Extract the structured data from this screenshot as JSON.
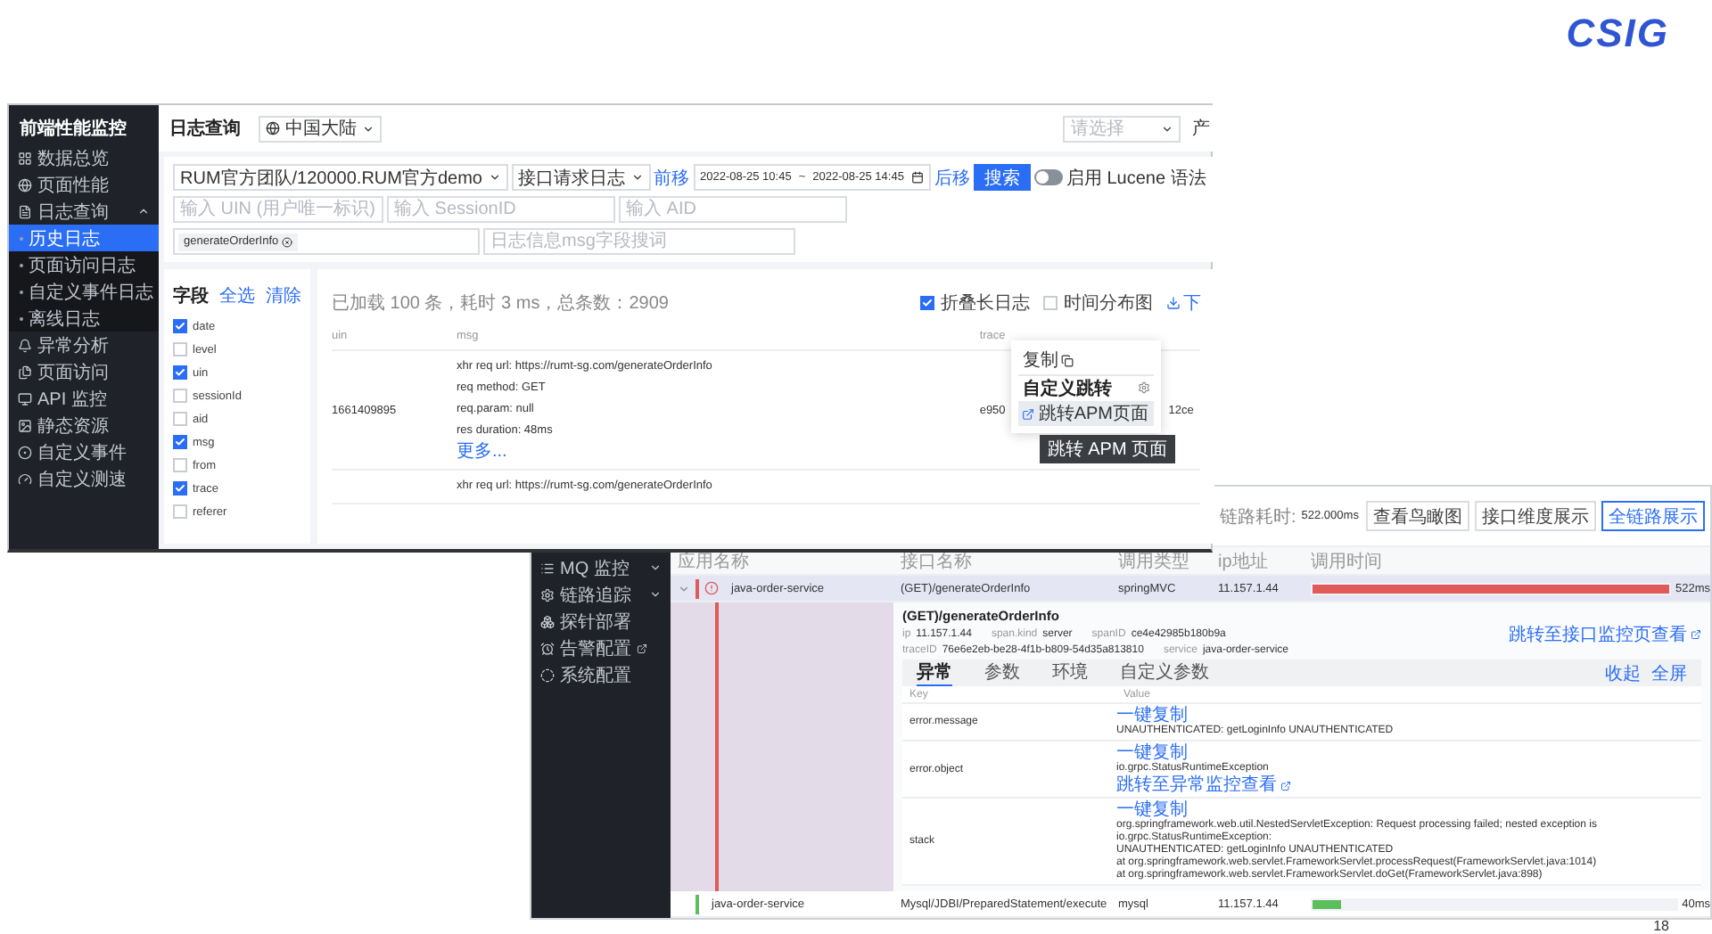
{
  "logo": {
    "text": "CSIG"
  },
  "page_number": "18",
  "log_query_window": {
    "sidebar": {
      "title": "前端性能监控",
      "items": [
        {
          "label": "数据总览",
          "selected": false
        },
        {
          "label": "页面性能",
          "selected": false
        },
        {
          "label": "日志查询",
          "selected": false,
          "expanded": true,
          "children": [
            {
              "label": "历史日志",
              "selected": true
            },
            {
              "label": "页面访问日志",
              "selected": false
            },
            {
              "label": "自定义事件日志",
              "selected": false
            },
            {
              "label": "离线日志",
              "selected": false
            }
          ]
        },
        {
          "label": "异常分析",
          "selected": false
        },
        {
          "label": "页面访问",
          "selected": false
        },
        {
          "label": "API 监控",
          "selected": false
        },
        {
          "label": "静态资源",
          "selected": false
        },
        {
          "label": "自定义事件",
          "selected": false
        },
        {
          "label": "自定义测速",
          "selected": false
        }
      ]
    },
    "header": {
      "title": "日志查询",
      "region": "中国大陆",
      "right_select": {
        "placeholder": "请选择"
      },
      "right_label": "产"
    },
    "filters": {
      "project": "RUM官方团队/120000.RUM官方demo",
      "log_type": "接口请求日志",
      "prev": "前移",
      "start": "2022-08-25 10:45",
      "separator": "~",
      "end": "2022-08-25 14:45",
      "next": "后移",
      "search_button": "搜索",
      "lucene": {
        "label": "启用 Lucene 语法",
        "on": false
      },
      "uin": {
        "placeholder": "输入 UIN (用户唯一标识)"
      },
      "session": {
        "placeholder": "输入 SessionID"
      },
      "aid": {
        "placeholder": "输入 AID"
      },
      "keyword_tags": [
        "generateOrderInfo"
      ],
      "msg": {
        "placeholder": "日志信息msg字段搜词"
      }
    },
    "fields": {
      "title": "字段",
      "select_all": "全选",
      "clear": "清除",
      "items": [
        {
          "label": "date",
          "checked": true
        },
        {
          "label": "level",
          "checked": false
        },
        {
          "label": "uin",
          "checked": true
        },
        {
          "label": "sessionId",
          "checked": false
        },
        {
          "label": "aid",
          "checked": false
        },
        {
          "label": "msg",
          "checked": true
        },
        {
          "label": "from",
          "checked": false
        },
        {
          "label": "trace",
          "checked": true
        },
        {
          "label": "referer",
          "checked": false
        }
      ]
    },
    "results": {
      "summary": "已加载 100 条，耗时 3 ms，总条数：2909",
      "options": [
        {
          "label": "折叠长日志",
          "checked": true
        },
        {
          "label": "时间分布图",
          "checked": false
        }
      ],
      "download": "下",
      "columns": [
        "uin",
        "msg",
        "trace"
      ],
      "rows": [
        {
          "uin": "1661409895",
          "msg": [
            "xhr req url: https://rumt-sg.com/generateOrderInfo",
            "req method: GET",
            "req.param: null",
            "res duration: 48ms"
          ],
          "more": "更多...",
          "trace_start": "e950",
          "trace_end": "12ce"
        },
        {
          "msg": [
            "xhr req url: https://rumt-sg.com/generateOrderInfo"
          ]
        }
      ]
    },
    "popup": {
      "copy": "复制",
      "section": "自定义跳转",
      "items": [
        {
          "label": "跳转APM页面",
          "selected": true
        }
      ],
      "tooltip": "跳转 APM 页面"
    }
  },
  "apm_window": {
    "toolbar": {
      "duration_label": "链路耗时:",
      "duration": "522.000ms",
      "buttons": [
        {
          "label": "查看鸟瞰图",
          "selected": false
        },
        {
          "label": "接口维度展示",
          "selected": false
        },
        {
          "label": "全链路展示",
          "selected": true
        }
      ]
    },
    "sidebar": {
      "items": [
        {
          "label": "MQ 监控",
          "expanded": false,
          "external_link": false
        },
        {
          "label": "链路追踪",
          "expanded": false,
          "external_link": false
        },
        {
          "label": "探针部署",
          "external_link": false
        },
        {
          "label": "告警配置",
          "external_link": true
        },
        {
          "label": "系统配置",
          "external_link": false
        }
      ]
    },
    "table": {
      "columns": [
        "应用名称",
        "接口名称",
        "调用类型",
        "ip地址",
        "调用时间"
      ],
      "rows": [
        {
          "service": "java-order-service",
          "interface": "(GET)/generateOrderInfo",
          "type": "springMVC",
          "ip": "11.157.1.44",
          "level": 1,
          "duration": "522ms",
          "color": "#e05a5a",
          "error": true,
          "selected": true,
          "expanded": true,
          "detail": {
            "title": "(GET)/generateOrderInfo",
            "link": "跳转至接口监控页查看",
            "attribute_rows": [
              [
                {
                  "key": "ip",
                  "value": "11.157.1.44"
                },
                {
                  "key": "span.kind",
                  "value": "server"
                },
                {
                  "key": "spanID",
                  "value": "ce4e42985b180b9a"
                }
              ],
              [
                {
                  "key": "traceID",
                  "value": "76e6e2eb-be28-4f1b-b809-54d35a813810"
                },
                {
                  "key": "service",
                  "value": "java-order-service"
                }
              ]
            ],
            "tabs": [
              {
                "label": "异常",
                "selected": true
              },
              {
                "label": "参数",
                "selected": false
              },
              {
                "label": "环境",
                "selected": false
              },
              {
                "label": "自定义参数",
                "selected": false
              }
            ],
            "collapse": "收起",
            "fullscreen": "全屏",
            "columns": [
              "Key",
              "Value"
            ],
            "rows": [
              {
                "key": "error.message",
                "copy": "一键复制",
                "lines": [
                  "UNAUTHENTICATED: getLoginInfo UNAUTHENTICATED"
                ]
              },
              {
                "key": "error.object",
                "copy": "一键复制",
                "lines": [
                  "io.grpc.StatusRuntimeException"
                ],
                "link": "跳转至异常监控查看"
              },
              {
                "key": "stack",
                "copy": "一键复制",
                "lines": [
                  "org.springframework.web.util.NestedServletException: Request processing failed; nested exception is io.grpc.StatusRuntimeException:",
                  "UNAUTHENTICATED: getLoginInfo UNAUTHENTICATED",
                  "at org.springframework.web.servlet.FrameworkServlet.processRequest(FrameworkServlet.java:1014)",
                  "at org.springframework.web.servlet.FrameworkServlet.doGet(FrameworkServlet.java:898)"
                ]
              }
            ]
          },
          "children": [
            {
              "service": "java-order-service",
              "interface": "Mysql/JDBI/PreparedStatement/execute",
              "type": "mysql",
              "ip": "11.157.1.44",
              "level": 0.08,
              "duration": "40ms",
              "color": "#5cbf5c",
              "error": false,
              "selected": false
            }
          ]
        }
      ]
    }
  }
}
